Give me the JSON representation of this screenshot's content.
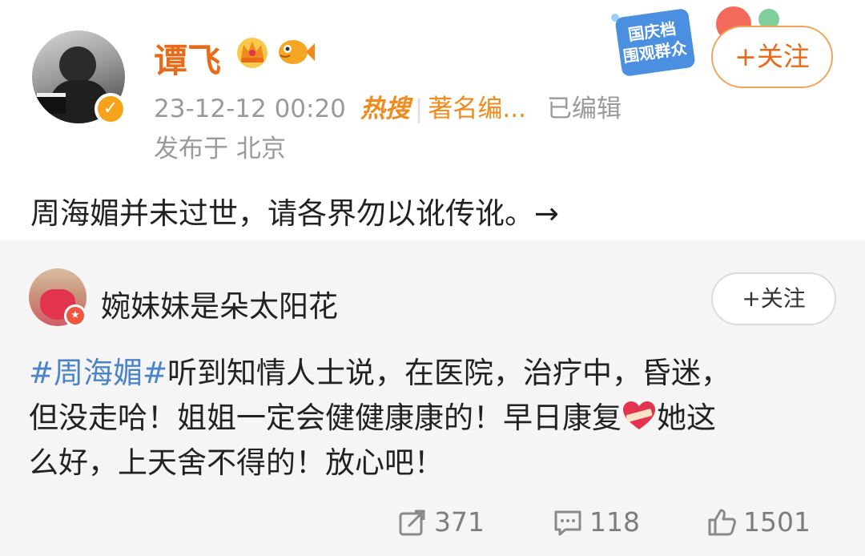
{
  "post": {
    "author": "谭飞",
    "time": "23-12-12 00:20",
    "hot_label": "热搜",
    "separator": "|",
    "author_title": "著名编...",
    "edited": "已编辑",
    "location": "发布于 北京",
    "follow_label": "+关注",
    "text": "周海媚并未过世，请各界勿以讹传讹。→",
    "promo_text": "国庆档围观群众"
  },
  "repost": {
    "author": "婉妹妹是朵太阳花",
    "follow_label": "+关注",
    "hashtag": "#周海媚#",
    "line1_rest": "听到知情人士说，在医院，治疗中，昏迷，",
    "line2_a": "但没走哈！姐姐一定会健健康康的！早日康复",
    "line2_b": "她这",
    "line3": "么好，上天舍不得的！放心吧！",
    "stats": {
      "reposts": "371",
      "comments": "118",
      "likes": "1501"
    }
  },
  "colors": {
    "accent": "#e86b19",
    "hashtag": "#4a84c7",
    "repost_bg": "#f5f5f5"
  },
  "icons": [
    "vip-crown-icon",
    "fish-icon",
    "verified-icon",
    "repost-icon",
    "comment-icon",
    "like-icon",
    "heart-bandage-icon"
  ]
}
